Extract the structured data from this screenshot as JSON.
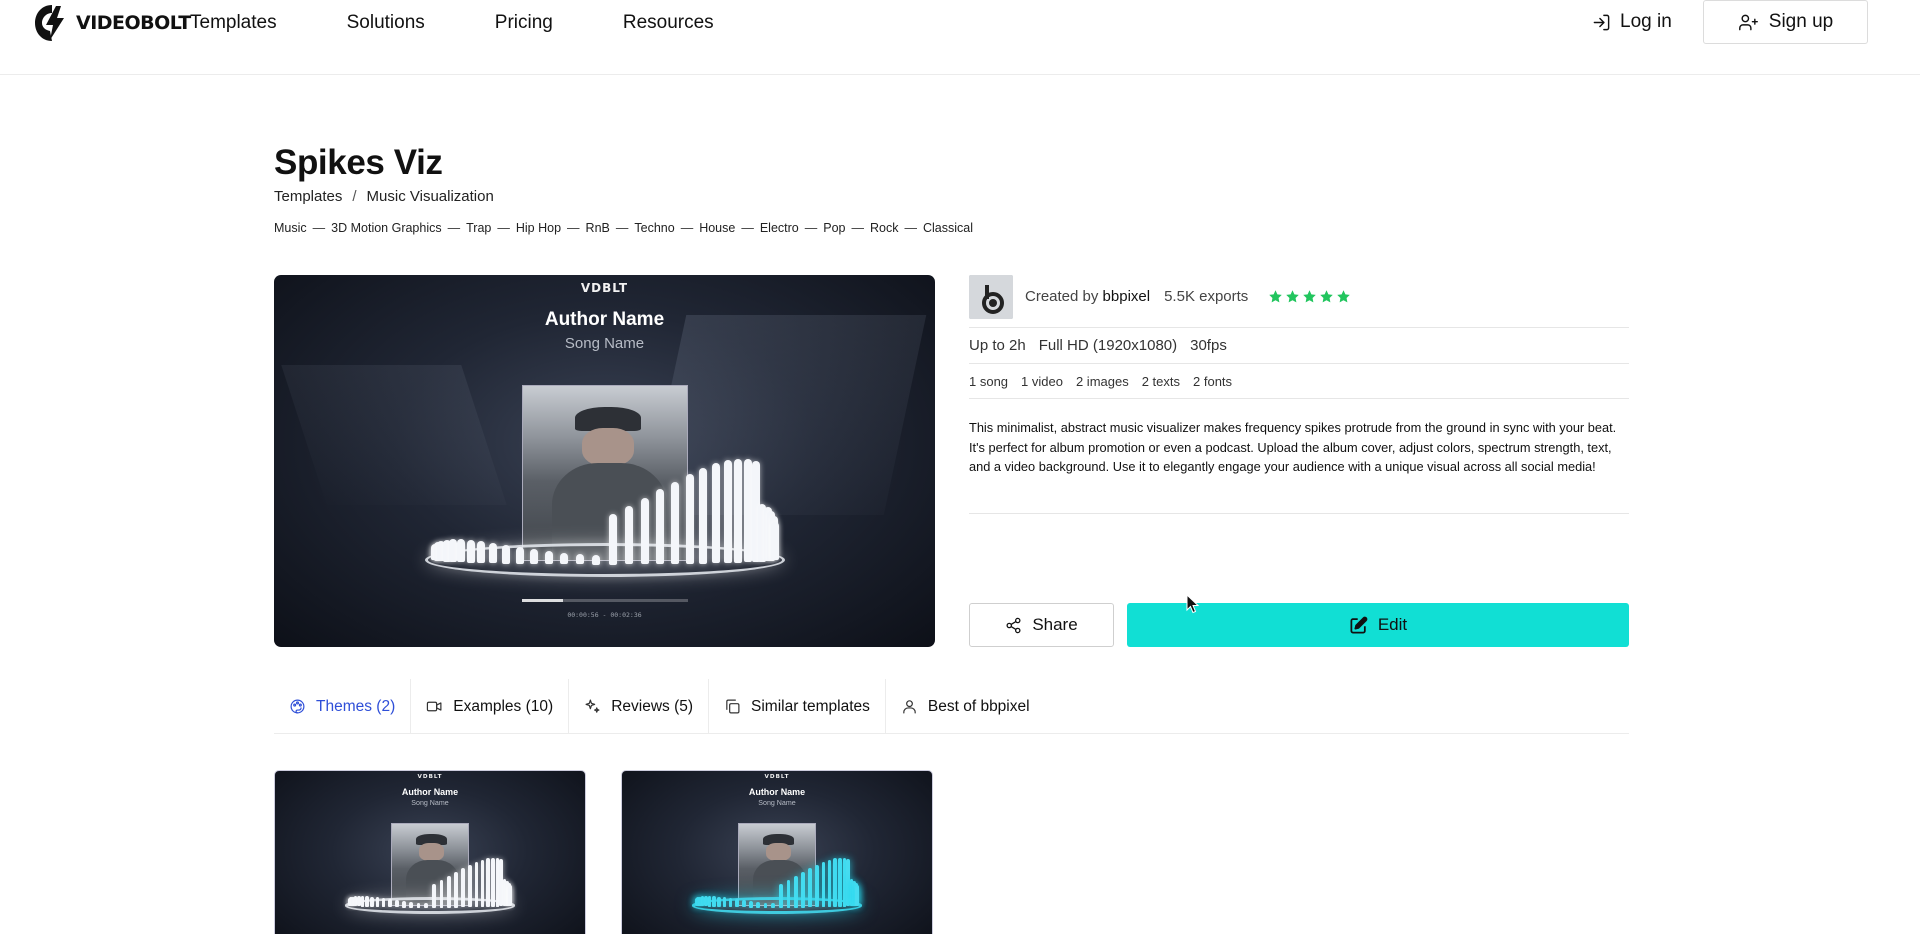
{
  "header": {
    "logo_text": "VIDEOBOLT",
    "nav": [
      "Templates",
      "Solutions",
      "Pricing",
      "Resources"
    ],
    "login_label": "Log in",
    "signup_label": "Sign up"
  },
  "template": {
    "title": "Spikes Viz",
    "breadcrumb": [
      "Templates",
      "Music Visualization"
    ],
    "breadcrumb_sep": "/",
    "tags": [
      "Music",
      "3D Motion Graphics",
      "Trap",
      "Hip Hop",
      "RnB",
      "Techno",
      "House",
      "Electro",
      "Pop",
      "Rock",
      "Classical"
    ],
    "tag_separator": "—"
  },
  "preview": {
    "brand": "VDBLT",
    "author": "Author Name",
    "song": "Song Name",
    "timecode": "00:00:56 - 00:02:36",
    "progress": 0.25
  },
  "info": {
    "created_prefix": "Created by",
    "creator": "bbpixel",
    "exports": "5.5K exports",
    "rating": 5,
    "star_color": "#22c55e",
    "specs": [
      "Up to 2h",
      "Full HD (1920x1080)",
      "30fps"
    ],
    "assets": [
      "1 song",
      "1 video",
      "2 images",
      "2 texts",
      "2 fonts"
    ],
    "description": "This minimalist, abstract music visualizer makes frequency spikes protrude from the ground in sync with your beat. It's perfect for album promotion or even a podcast. Upload the album cover, adjust colors, spectrum strength, text, and a video background. Use it to elegantly engage your audience with a unique visual across all social media!"
  },
  "actions": {
    "share_label": "Share",
    "edit_label": "Edit",
    "edit_color": "#11dfd4"
  },
  "tabs": [
    {
      "label": "Themes (2)",
      "icon": "palette-icon",
      "active": true
    },
    {
      "label": "Examples (10)",
      "icon": "video-camera-icon",
      "active": false
    },
    {
      "label": "Reviews (5)",
      "icon": "sparkles-icon",
      "active": false
    },
    {
      "label": "Similar templates",
      "icon": "copy-icon",
      "active": false
    },
    {
      "label": "Best of bbpixel",
      "icon": "user-icon",
      "active": false
    }
  ],
  "themes": [
    {
      "brand": "VDBLT",
      "author": "Author Name",
      "song": "Song Name",
      "accent": "#f4f6fa"
    },
    {
      "brand": "VDBLT",
      "author": "Author Name",
      "song": "Song Name",
      "accent": "#46dcf0"
    }
  ]
}
